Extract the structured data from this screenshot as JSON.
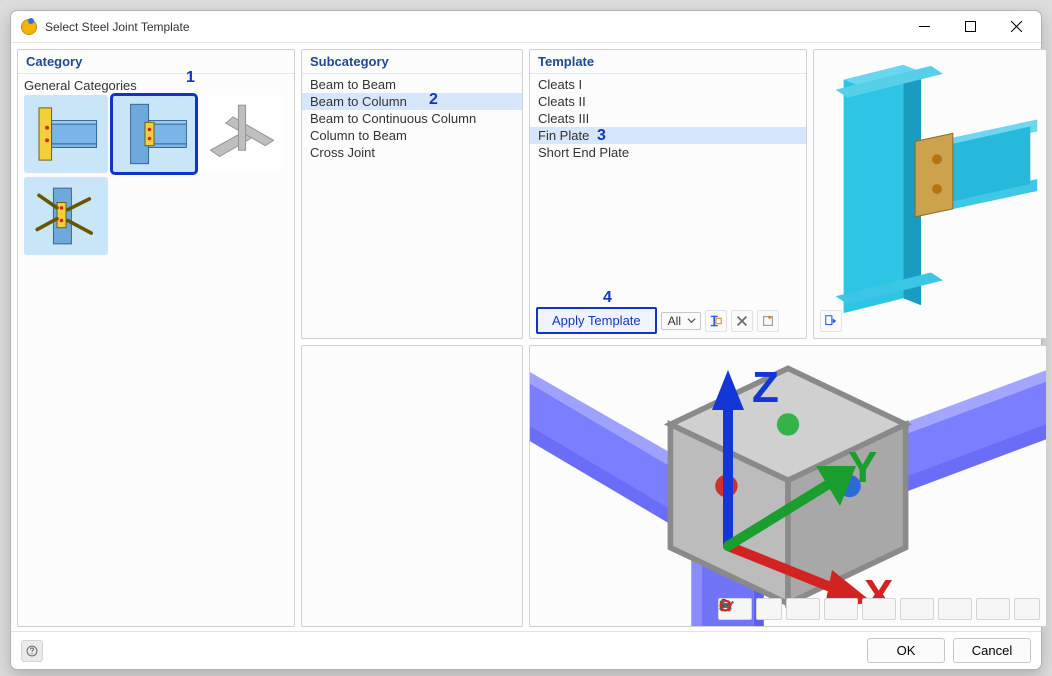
{
  "window": {
    "title": "Select Steel Joint Template"
  },
  "category": {
    "header": "Category",
    "group_label": "General Categories"
  },
  "subcategory": {
    "header": "Subcategory",
    "items": [
      "Beam to Beam",
      "Beam to Column",
      "Beam to Continuous Column",
      "Column to Beam",
      "Cross Joint"
    ],
    "selected_index": 1
  },
  "template": {
    "header": "Template",
    "items": [
      "Cleats I",
      "Cleats II",
      "Cleats III",
      "Fin Plate",
      "Short End Plate"
    ],
    "selected_index": 3,
    "apply_label": "Apply Template",
    "filter_label": "All"
  },
  "viewport": {
    "axes": {
      "x": "X",
      "y": "Y",
      "z": "Z"
    }
  },
  "footer": {
    "ok": "OK",
    "cancel": "Cancel"
  },
  "annotations": {
    "a1": "1",
    "a2": "2",
    "a3": "3",
    "a4": "4"
  }
}
